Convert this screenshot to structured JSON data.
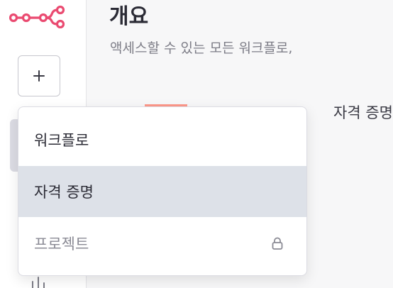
{
  "sidebar": {
    "logo_icon": "n8n-logo-icon",
    "add_icon": "plus-icon",
    "bottom_icon": "bar-chart-icon",
    "brand_color": "#ea4b71"
  },
  "main": {
    "title": "개요",
    "subtitle": "액세스할 수 있는 모든 워크플로,",
    "behind_tab": "자격 증명"
  },
  "dropdown": {
    "items": [
      {
        "label": "워크플로",
        "highlighted": false,
        "locked": false
      },
      {
        "label": "자격 증명",
        "highlighted": true,
        "locked": false
      },
      {
        "label": "프로젝트",
        "highlighted": false,
        "locked": true,
        "icon": "lock-icon"
      }
    ],
    "highlight_color": "#dde1e8"
  }
}
